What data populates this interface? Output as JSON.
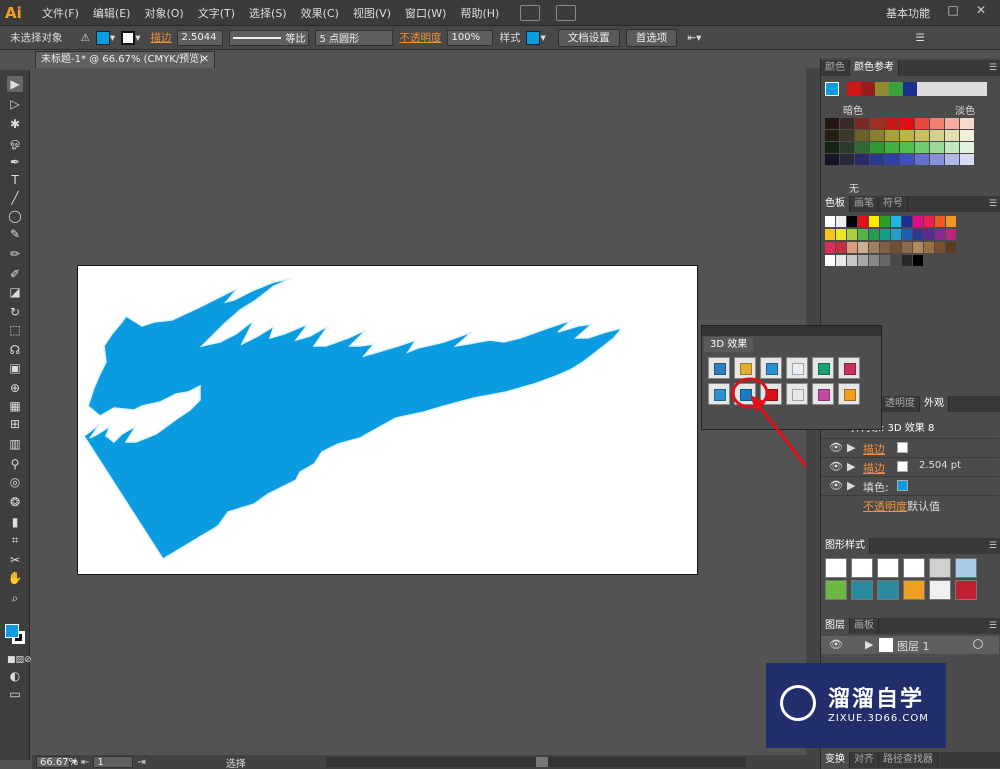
{
  "app": {
    "logo": "Ai",
    "workspace": "基本功能",
    "window_controls": [
      "–",
      "□",
      "✕"
    ]
  },
  "menu": [
    "文件(F)",
    "编辑(E)",
    "对象(O)",
    "文字(T)",
    "选择(S)",
    "效果(C)",
    "视图(V)",
    "窗口(W)",
    "帮助(H)"
  ],
  "control_bar": {
    "selection": "未选择对象",
    "stroke_label": "描边",
    "stroke_value": "2.5044",
    "profile": "等比",
    "brush": "5 点圆形",
    "opacity_label": "不透明度",
    "opacity_value": "100%",
    "style_label": "样式",
    "doc_setup": "文档设置",
    "preferences": "首选项"
  },
  "document": {
    "tab_title": "未标题-1* @ 66.67% (CMYK/预览)",
    "tab_close": "✕"
  },
  "status_bar": {
    "zoom": "66.67%",
    "page": "1",
    "tool": "选择"
  },
  "panels": {
    "color_guide": {
      "tabs": [
        "颜色",
        "颜色参考"
      ],
      "dark_label": "暗色",
      "light_label": "淡色",
      "footer": "无"
    },
    "swatches": {
      "tabs": [
        "色板",
        "画笔",
        "符号"
      ]
    },
    "effect_3d": {
      "tab": "3D 效果"
    },
    "appearance": {
      "tabs": [
        "透明度",
        "外观"
      ],
      "title": "择对象: 3D 效果 8",
      "rows": [
        {
          "label": "描边",
          "value": ""
        },
        {
          "label": "描边",
          "value": "2.504 pt"
        },
        {
          "label": "填色:",
          "value": ""
        },
        {
          "label": "不透明度",
          "value": "默认值"
        }
      ]
    },
    "graphic_styles": {
      "tab": "图形样式"
    },
    "layers": {
      "tabs": [
        "图层",
        "画板"
      ],
      "layer_name": "图层 1"
    },
    "bottom_tabs": [
      "变换",
      "对齐",
      "路径查找器"
    ]
  },
  "watermark": {
    "title": "溜溜自学",
    "subtitle": "ZIXUE.3D66.COM"
  },
  "colors": {
    "fill": "#0a9be0",
    "accent_orange": "#f0923b",
    "annotation_red": "#e0101a"
  }
}
